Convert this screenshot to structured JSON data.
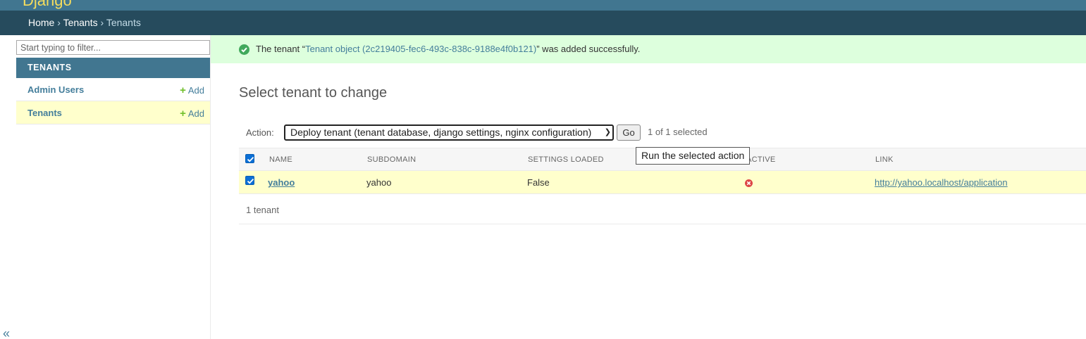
{
  "header": {
    "brand": "Django"
  },
  "breadcrumbs": {
    "home": "Home",
    "app": "Tenants",
    "current": "Tenants",
    "separator": "›"
  },
  "sidebar": {
    "filter_placeholder": "Start typing to filter...",
    "module_caption": "TENANTS",
    "items": [
      {
        "label": "Admin Users",
        "add_label": "Add"
      },
      {
        "label": "Tenants",
        "add_label": "Add"
      }
    ],
    "collapse_label": "«"
  },
  "message": {
    "prefix": "The tenant “",
    "link": "Tenant object (2c219405-fec6-493c-838c-9188e4f0b121)",
    "suffix": "” was added successfully."
  },
  "page_title": "Select tenant to change",
  "actions": {
    "label": "Action:",
    "selected_option": "Deploy tenant (tenant database, django settings, nginx configuration)",
    "go_label": "Go",
    "selected_count": "1 of 1 selected",
    "tooltip": "Run the selected action"
  },
  "table": {
    "columns": [
      "NAME",
      "SUBDOMAIN",
      "SETTINGS LOADED",
      "ACTIVE",
      "LINK"
    ],
    "rows": [
      {
        "name": "yahoo",
        "subdomain": "yahoo",
        "settings_loaded": "False",
        "active": false,
        "link": "http://yahoo.localhost/application"
      }
    ],
    "footer": "1 tenant"
  },
  "colors": {
    "header": "#417690",
    "breadcrumbs": "#264b5d",
    "success_bg": "#ddffdd",
    "selected_row": "#ffffcc",
    "link": "#447e9b"
  }
}
